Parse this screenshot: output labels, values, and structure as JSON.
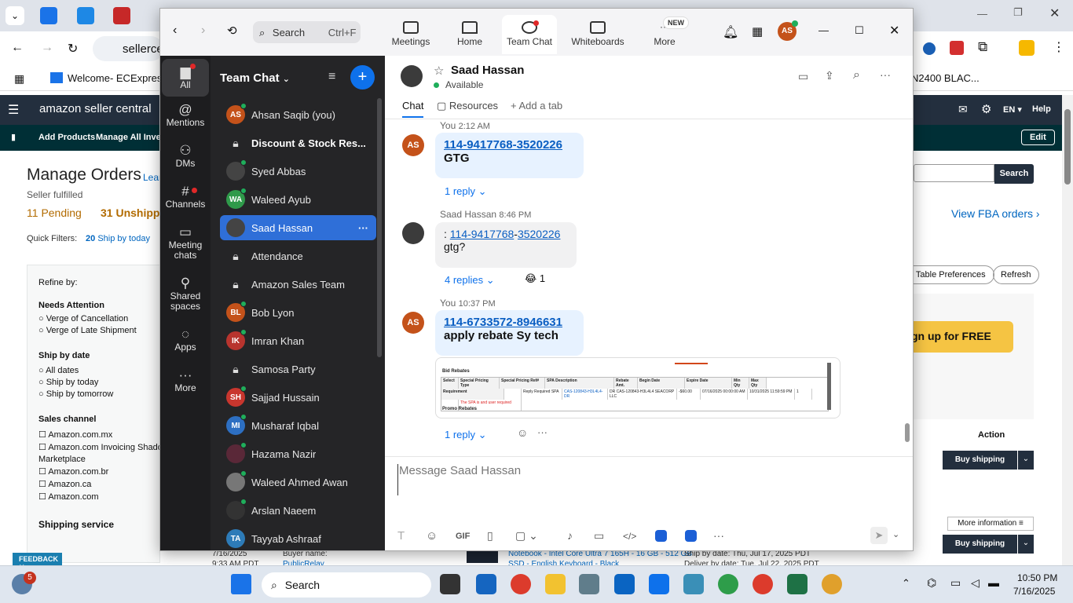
{
  "browser": {
    "address": "sellerce",
    "bookmarks": [
      {
        "label": "Welcome- ECExpres..."
      },
      {
        "label": "N2400 BLAC..."
      }
    ]
  },
  "amazon": {
    "logo": "amazon seller central",
    "lang": "EN",
    "help": "Help",
    "sub_nav": [
      "Add Products",
      "Manage All Invent"
    ],
    "edit": "Edit",
    "page_title": "Manage Orders",
    "learn": "Lear",
    "seller_fulfilled": "Seller fulfilled",
    "tabs": [
      {
        "count": "11",
        "label": "Pending"
      },
      {
        "count": "31",
        "label": "Unshipp"
      }
    ],
    "quick_filters_label": "Quick Filters:",
    "quick_filter": {
      "count": "20",
      "label": "Ship by today"
    },
    "refine": "Refine by:",
    "needs_attention": "Needs Attention",
    "attention_opts": [
      "Verge of Cancellation",
      "Verge of Late Shipment"
    ],
    "ship_by_date": "Ship by date",
    "ship_opts": [
      "All dates",
      "Ship by today",
      "Ship by tomorrow"
    ],
    "sales_channel": "Sales channel",
    "channels": [
      "Amazon.com.mx",
      "Amazon.com Invoicing Shado",
      "Marketplace",
      "Amazon.com.br",
      "Amazon.ca",
      "Amazon.com"
    ],
    "shipping_service": "Shipping service",
    "search_btn": "Search",
    "view_fba": "View FBA orders ›",
    "table_pref": "t Table Preferences",
    "refresh": "Refresh",
    "signup": "gn up for FREE",
    "action_header": "Action",
    "buy_shipping": "Buy shipping",
    "more_info": "More information ≡",
    "feedback": "FEEDBACK",
    "row_date": "7/16/2025",
    "row_time": "9:33 AM PDT",
    "buyer_name": "Buyer name:",
    "buyer_value": "PublicRelay",
    "product": "Notebook - Intel Core Ultra 7 165H - 16 GB - 512 GB",
    "product2": "SSD - English Keyboard - Black",
    "ship_by": "Ship by date: Thu, Jul 17, 2025 PDT",
    "deliver_by": "Deliver by date: Tue, Jul 22, 2025 PDT"
  },
  "zoom": {
    "search": {
      "placeholder": "Search",
      "shortcut": "Ctrl+F"
    },
    "nav": [
      {
        "label": "Meetings"
      },
      {
        "label": "Home"
      },
      {
        "label": "Team Chat"
      },
      {
        "label": "Whiteboards"
      },
      {
        "label": "More",
        "badge": "NEW"
      }
    ],
    "rail": [
      {
        "label": "All",
        "icon": "chat-bubble"
      },
      {
        "label": "Mentions",
        "icon": "at"
      },
      {
        "label": "DMs",
        "icon": "people"
      },
      {
        "label": "Channels",
        "icon": "hash"
      },
      {
        "label": "Meeting chats",
        "icon": "calendar"
      },
      {
        "label": "Shared spaces",
        "icon": "share"
      },
      {
        "label": "Apps",
        "icon": "apps"
      },
      {
        "label": "More",
        "icon": "ellipsis"
      }
    ],
    "list_title": "Team Chat",
    "chats": [
      {
        "name": "Ahsan Saqib (you)",
        "initials": "AS",
        "color": "#c4521a",
        "presence": true
      },
      {
        "name": "Discount & Stock Res...",
        "initials": "",
        "color": "",
        "bold": true,
        "lock": true
      },
      {
        "name": "Syed Abbas",
        "initials": "",
        "color": "#444",
        "presence": true
      },
      {
        "name": "Waleed Ayub",
        "initials": "WA",
        "color": "#2f9a4a",
        "presence": true
      },
      {
        "name": "Saad Hassan",
        "initials": "",
        "color": "#444",
        "active": true
      },
      {
        "name": "Attendance",
        "initials": "",
        "color": "",
        "lock": true
      },
      {
        "name": "Amazon Sales Team",
        "initials": "",
        "color": "",
        "lock": true
      },
      {
        "name": "Bob Lyon",
        "initials": "BL",
        "color": "#c4521a",
        "presence": true
      },
      {
        "name": "Imran Khan",
        "initials": "IK",
        "color": "#b8342e",
        "presence": true
      },
      {
        "name": "Samosa Party",
        "initials": "",
        "color": "",
        "lock": true
      },
      {
        "name": "Sajjad Hussain",
        "initials": "SH",
        "color": "#c8362e",
        "presence": true
      },
      {
        "name": "Musharaf Iqbal",
        "initials": "MI",
        "color": "#2d6fc2",
        "presence": true
      },
      {
        "name": "Hazama Nazir",
        "initials": "",
        "color": "#5a2838",
        "presence": true
      },
      {
        "name": "Waleed Ahmed Awan",
        "initials": "",
        "color": "#777",
        "presence": true
      },
      {
        "name": "Arslan Naeem",
        "initials": "",
        "color": "#333",
        "presence": true
      },
      {
        "name": "Tayyab Ashraaf",
        "initials": "TA",
        "color": "#2d7bb8",
        "presence": false
      }
    ],
    "contact": {
      "name": "Saad Hassan",
      "status": "Available"
    },
    "chat_tabs": [
      {
        "label": "Chat"
      },
      {
        "label": "Resources"
      },
      {
        "label": "Add a tab"
      }
    ],
    "messages": [
      {
        "author": "You",
        "time": "2:12 AM",
        "initials": "AS",
        "link": "114-9417768-3520226",
        "text": "GTG",
        "replies": "1 reply"
      },
      {
        "author": "Saad Hassan",
        "time": "8:46 PM",
        "prefix": ": ",
        "link_a": "114-9417768",
        "link_sep": "-",
        "link_b": "3520226",
        "text": "gtg?",
        "replies": "4 replies",
        "reaction": "😂",
        "reaction_count": "1"
      },
      {
        "author": "You",
        "time": "10:37 PM",
        "initials": "AS",
        "link": "114-6733572-8946631",
        "text": "apply rebate Sy tech",
        "replies": "1 reply"
      }
    ],
    "attachment": {
      "title": "Bid Rebates",
      "headers": [
        "Select",
        "Special Pricing Type",
        "Special Pricing Ref#",
        "SPA Description",
        "Rebate Amt.",
        "Begin Date",
        "Expire Date",
        "Min Qty",
        "Max Qty",
        "Requirement"
      ],
      "row": [
        "",
        "Reply Required SPA",
        "CAS-120843-H3L4L4-DR",
        "DR CAS-120843-H3L4L4 SEACORP LLC",
        "-$60.00",
        "07/16/2025 00:00:00 AM",
        "10/31/2025 11:59:59 PM",
        "1",
        "",
        "The SPA is and user required"
      ],
      "footer": "Promo Rebates"
    },
    "compose_placeholder": "Message Saad Hassan",
    "toolbar": [
      "T",
      "☺",
      "GIF",
      "▯",
      "▢ ⌄",
      "🎤",
      "▭",
      "</>",
      "▣",
      "▣",
      "···"
    ]
  },
  "taskbar": {
    "notif_count": "5",
    "search": "Search",
    "time": "10:50 PM",
    "date": "7/16/2025"
  }
}
